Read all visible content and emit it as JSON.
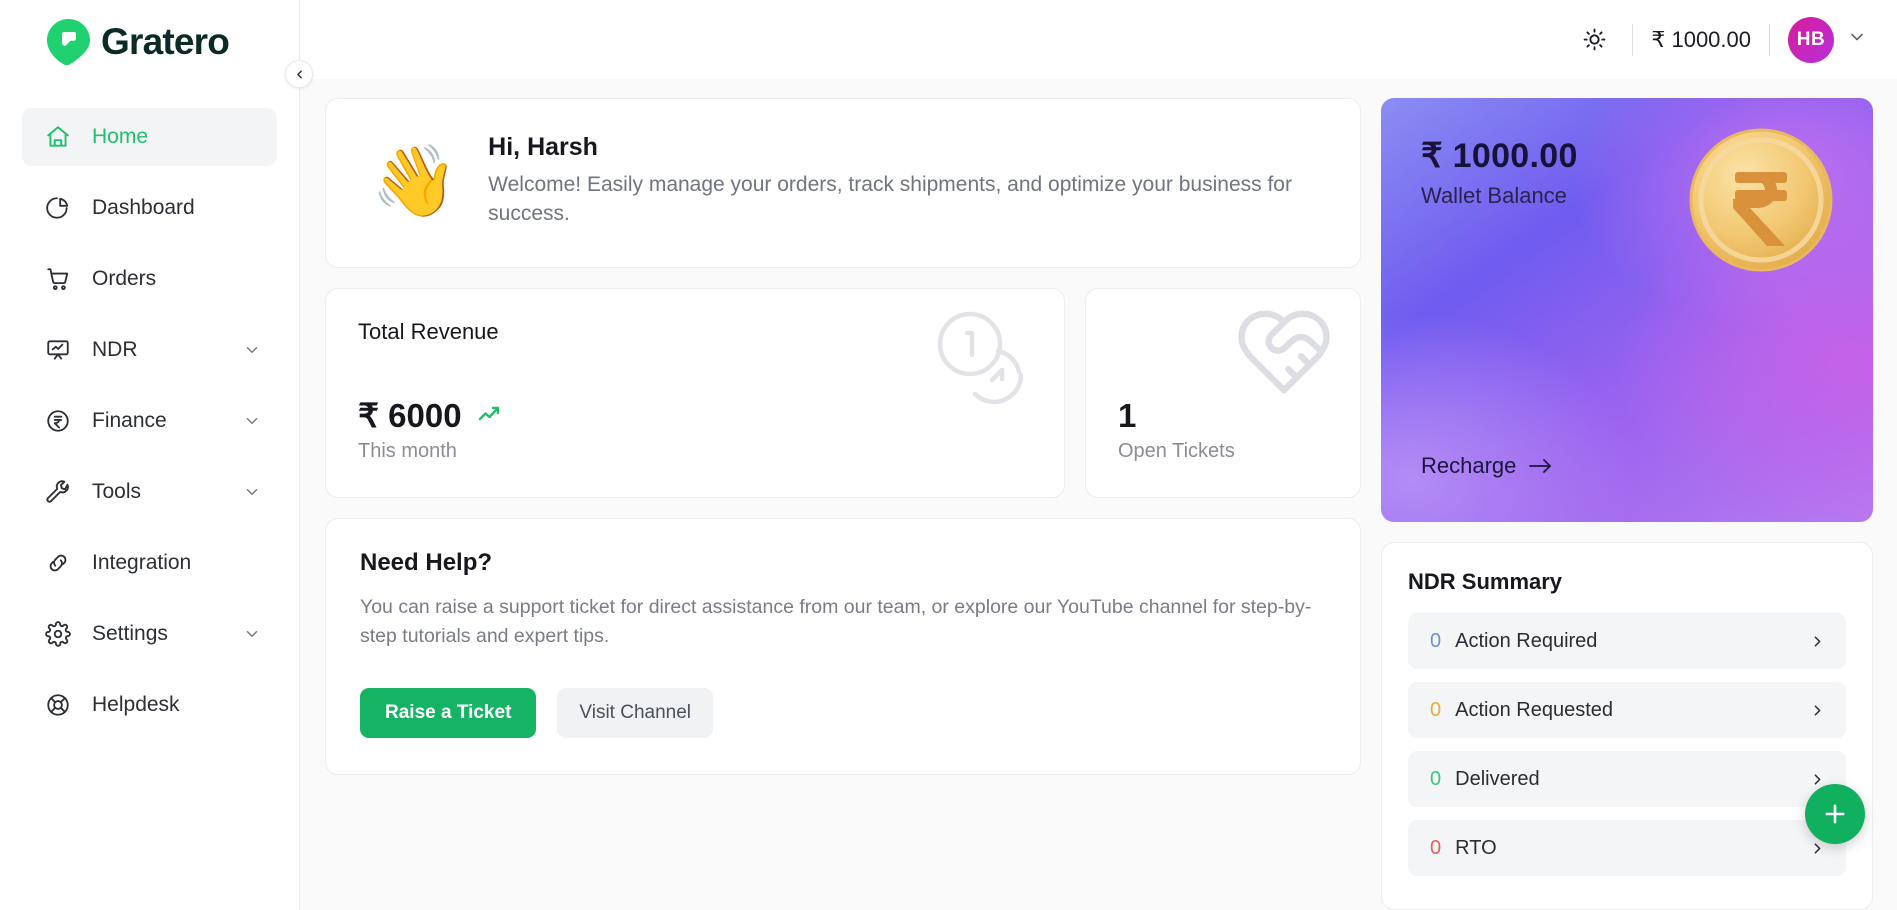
{
  "brand": {
    "name": "Gratero",
    "accent": "#22c06f",
    "logo_icon": "location-pin-logo"
  },
  "sidebar": {
    "collapse_icon": "chevron-left-icon",
    "items": [
      {
        "label": "Home",
        "icon": "home-icon",
        "active": true,
        "expandable": false
      },
      {
        "label": "Dashboard",
        "icon": "pie-chart-icon",
        "active": false,
        "expandable": false
      },
      {
        "label": "Orders",
        "icon": "shopping-cart-icon",
        "active": false,
        "expandable": false
      },
      {
        "label": "NDR",
        "icon": "presentation-chart-icon",
        "active": false,
        "expandable": true
      },
      {
        "label": "Finance",
        "icon": "rupee-circle-icon",
        "active": false,
        "expandable": true
      },
      {
        "label": "Tools",
        "icon": "wrench-icon",
        "active": false,
        "expandable": true
      },
      {
        "label": "Integration",
        "icon": "link-icon",
        "active": false,
        "expandable": false
      },
      {
        "label": "Settings",
        "icon": "gear-icon",
        "active": false,
        "expandable": true
      },
      {
        "label": "Helpdesk",
        "icon": "lifebuoy-icon",
        "active": false,
        "expandable": false
      }
    ]
  },
  "topbar": {
    "theme_icon": "sun-icon",
    "balance": "₹ 1000.00",
    "avatar_initials": "HB",
    "avatar_chevron_icon": "chevron-down-icon"
  },
  "welcome": {
    "icon": "waving-hand-emoji",
    "greeting": "Hi, Harsh",
    "message": "Welcome! Easily manage your orders, track shipments, and optimize your business for success."
  },
  "stats": {
    "revenue": {
      "title": "Total Revenue",
      "value": "₹ 6000",
      "subtitle": "This month",
      "trend_icon": "trending-up-icon",
      "watermark_icon": "coins-icon"
    },
    "tickets": {
      "value": "1",
      "label": "Open Tickets",
      "watermark_icon": "heart-handshake-icon"
    }
  },
  "help": {
    "title": "Need Help?",
    "body": "You can raise a support ticket for direct assistance from our team, or explore our YouTube channel for step-by-step tutorials and expert tips.",
    "primary_button": "Raise a Ticket",
    "secondary_button": "Visit Channel"
  },
  "wallet": {
    "amount": "₹ 1000.00",
    "label": "Wallet Balance",
    "recharge_label": "Recharge",
    "recharge_arrow_icon": "arrow-right-icon",
    "coin_icon": "rupee-coin-icon"
  },
  "ndr": {
    "title": "NDR Summary",
    "chevron_icon": "chevron-right-icon",
    "rows": [
      {
        "count": "0",
        "label": "Action Required",
        "color": "#6e8fe0"
      },
      {
        "count": "0",
        "label": "Action Requested",
        "color": "#e5ad3c"
      },
      {
        "count": "0",
        "label": "Delivered",
        "color": "#3cc67e"
      },
      {
        "count": "0",
        "label": "RTO",
        "color": "#e4615c"
      }
    ]
  },
  "fab": {
    "icon": "plus-icon"
  }
}
